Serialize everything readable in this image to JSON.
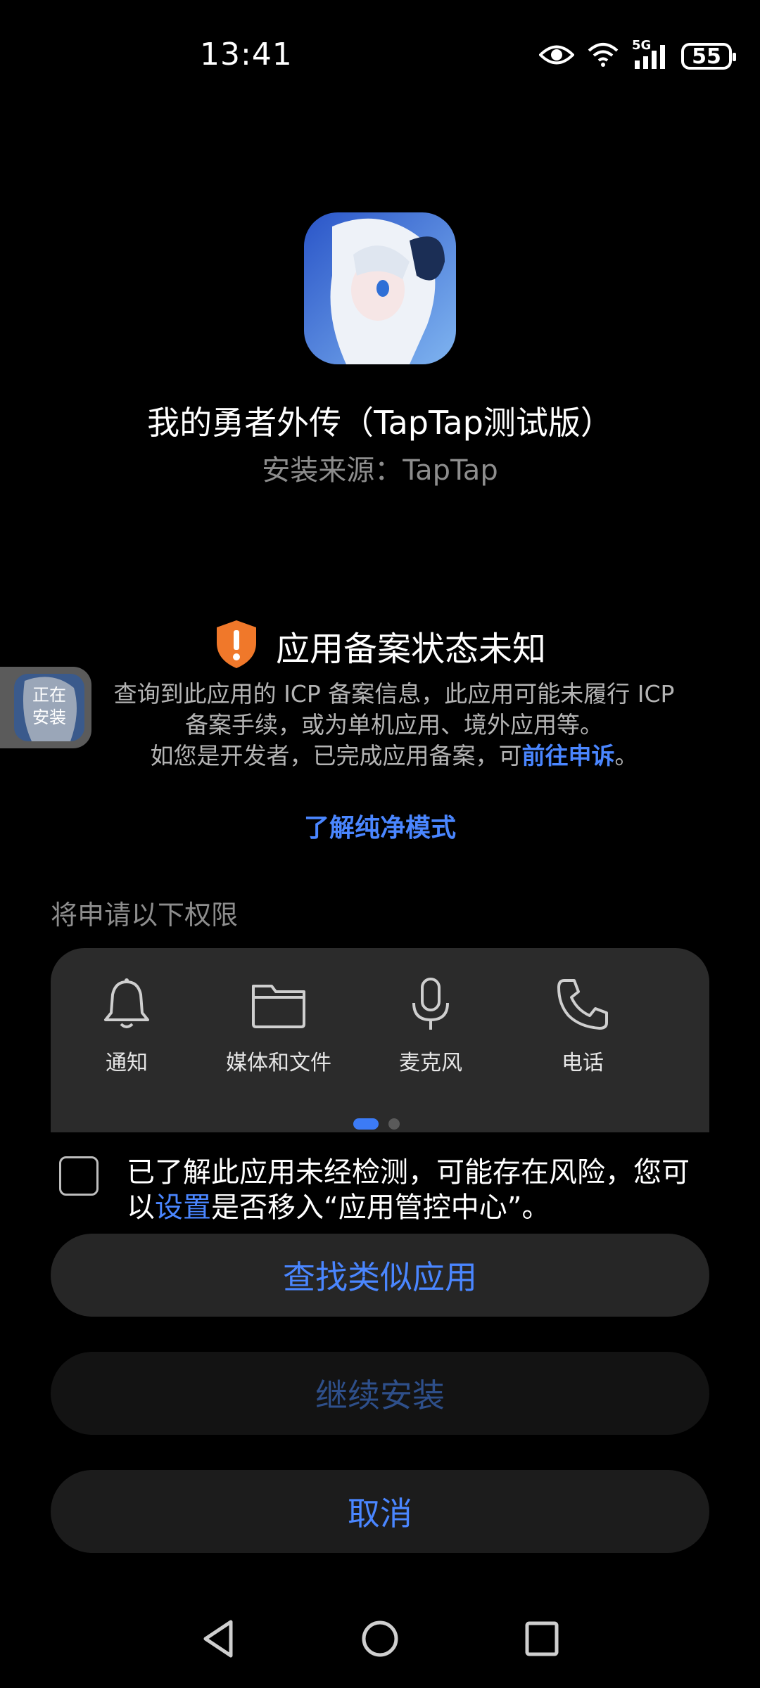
{
  "status_bar": {
    "time": "13:41",
    "network": "5G",
    "battery": "55",
    "icons": [
      "eye-icon",
      "wifi-icon",
      "signal-icon",
      "battery-icon"
    ]
  },
  "app": {
    "name": "我的勇者外传（TapTap测试版）",
    "source": "安装来源：TapTap"
  },
  "floating_bubble": {
    "label_line1": "正在",
    "label_line2": "安装"
  },
  "warning": {
    "title": "应用备案状态未知",
    "body_line1": "查询到此应用的 ICP 备案信息，此应用可能未履行 ICP",
    "body_line2": "备案手续，或为单机应用、境外应用等。",
    "body_line3_prefix": "如您是开发者，已完成应用备案，可",
    "appeal_link": "前往申诉",
    "body_line3_suffix": "。",
    "pure_mode_link": "了解纯净模式",
    "accent_color": "#f0782a"
  },
  "permissions": {
    "title": "将申请以下权限",
    "items": [
      {
        "label": "通知",
        "icon": "bell-icon"
      },
      {
        "label": "媒体和文件",
        "icon": "folder-icon"
      },
      {
        "label": "麦克风",
        "icon": "microphone-icon"
      },
      {
        "label": "电话",
        "icon": "phone-icon"
      }
    ],
    "page_index": 1,
    "page_count": 2
  },
  "consent": {
    "text_prefix": "已了解此应用未经检测，可能存在风险，您可以",
    "settings_link": "设置",
    "text_suffix": "是否移入“应用管控中心”。",
    "checked": false
  },
  "buttons": {
    "find_similar": "查找类似应用",
    "continue_install": "继续安装",
    "cancel": "取消"
  },
  "colors": {
    "background": "#000000",
    "link": "#4a86ff",
    "card": "#2b2b2b"
  }
}
